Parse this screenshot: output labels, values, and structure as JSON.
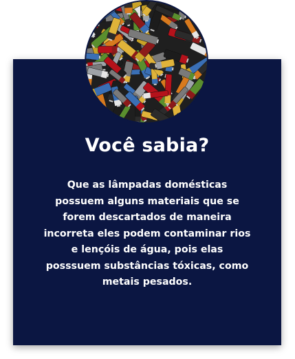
{
  "image": {
    "alt_semantic": "batteries-pile-photo"
  },
  "card": {
    "title": "Você sabia?",
    "text": "Que as lâmpadas domésticas possuem alguns materiais que se forem descartados de maneira incorreta eles podem contaminar rios e lençóis de água, pois elas posssuem substâncias tóxicas, como metais pesados."
  },
  "colors": {
    "card_background": "#0b1642",
    "text": "#ffffff"
  }
}
